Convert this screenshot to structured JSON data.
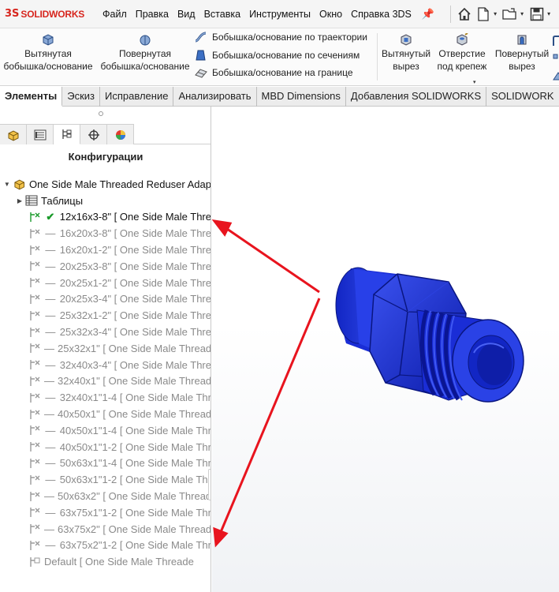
{
  "app": {
    "logo_ds": "3S",
    "logo_name": "SOLIDWORKS"
  },
  "menu": [
    "Файл",
    "Правка",
    "Вид",
    "Вставка",
    "Инструменты",
    "Окно",
    "Справка 3DS"
  ],
  "ribbon": {
    "extruded_boss_1": "Вытянутая",
    "extruded_boss_2": "бобышка/основание",
    "revolved_boss_1": "Повернутая",
    "revolved_boss_2": "бобышка/основание",
    "sweep": "Бобышка/основание по траектории",
    "loft": "Бобышка/основание по сечениям",
    "boundary": "Бобышка/основание на границе",
    "extruded_cut_1": "Вытянутый",
    "extruded_cut_2": "вырез",
    "hole_wizard_1": "Отверстие",
    "hole_wizard_2": "под крепеж",
    "revolved_cut_1": "Повернутый",
    "revolved_cut_2": "вырез"
  },
  "tabs": [
    "Элементы",
    "Эскиз",
    "Исправление",
    "Анализировать",
    "MBD Dimensions",
    "Добавления SOLIDWORKS",
    "SOLIDWORK"
  ],
  "panel": {
    "title": "Конфигурации",
    "root": "One Side Male Threaded Reduser Adap",
    "tables": "Таблицы",
    "configs": [
      {
        "label": "12x16x3-8\" [ One Side Male Thre",
        "active": true
      },
      {
        "label": "16x20x3-8\" [ One Side Male Thre",
        "active": false
      },
      {
        "label": "16x20x1-2\" [ One Side Male Thre",
        "active": false
      },
      {
        "label": "20x25x3-8\" [ One Side Male Thre",
        "active": false
      },
      {
        "label": "20x25x1-2\" [ One Side Male Thre",
        "active": false
      },
      {
        "label": "20x25x3-4\" [ One Side Male Thre",
        "active": false
      },
      {
        "label": "25x32x1-2\" [ One Side Male Thre",
        "active": false
      },
      {
        "label": "25x32x3-4\" [ One Side Male Thre",
        "active": false
      },
      {
        "label": "25x32x1\" [ One Side Male Thread",
        "active": false
      },
      {
        "label": "32x40x3-4\" [ One Side Male Thre",
        "active": false
      },
      {
        "label": "32x40x1\" [ One Side Male Thread",
        "active": false
      },
      {
        "label": "32x40x1\"1-4 [ One Side Male Thr",
        "active": false
      },
      {
        "label": "40x50x1\" [ One Side Male Thread",
        "active": false
      },
      {
        "label": "40x50x1\"1-4 [ One Side Male Thr",
        "active": false
      },
      {
        "label": "40x50x1\"1-2 [ One Side Male Thr",
        "active": false
      },
      {
        "label": "50x63x1\"1-4 [ One Side Male Thr",
        "active": false
      },
      {
        "label": "50x63x1\"1-2 [ One Side Male Thr",
        "active": false
      },
      {
        "label": "50x63x2\" [ One Side Male Thread",
        "active": false
      },
      {
        "label": "63x75x1\"1-2 [ One Side Male Thr",
        "active": false
      },
      {
        "label": "63x75x2\" [ One Side Male Thread",
        "active": false
      },
      {
        "label": "63x75x2\"1-2 [ One Side Male Thr",
        "active": false
      },
      {
        "label": "Default [ One Side Male Threade",
        "active": false,
        "default": true
      }
    ]
  },
  "colors": {
    "accent": "#d7261e",
    "part": "#1428c8",
    "arrow": "#e8141e",
    "active_check": "#1a9a2a"
  }
}
